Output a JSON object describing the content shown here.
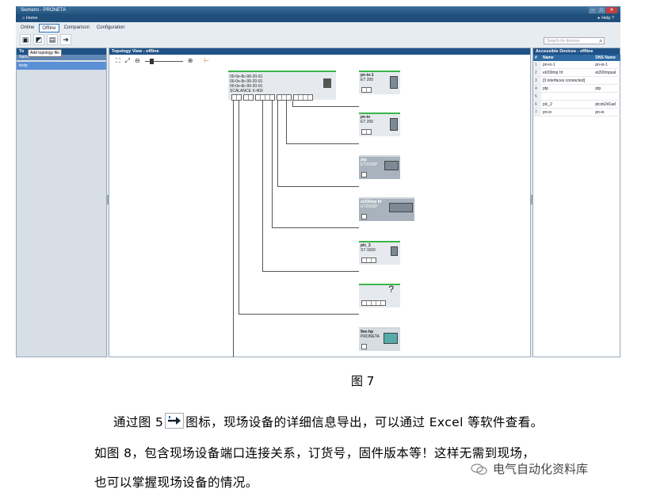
{
  "app": {
    "window_title": "Siemens - PRONETA",
    "home_label": "Home",
    "help_label": "Help ?",
    "tabs": [
      "Online",
      "Offline",
      "Comparison",
      "Configuration"
    ],
    "tooltip": "Add topology file",
    "search_placeholder": "Search for devices"
  },
  "left_panel": {
    "header": "To",
    "column": "Name",
    "item": "testp"
  },
  "topology": {
    "header": "Topology View - offline",
    "switch": {
      "macs": [
        "00-0e-8c-99-20-91",
        "00-0e-8c-99-20-91",
        "00-0e-8c-99-20-91"
      ],
      "model": "SCALANCE X-400"
    },
    "devices": [
      {
        "name": "pn-io-1",
        "type": "ET 200"
      },
      {
        "name": "pn-io",
        "type": "ET 200"
      },
      {
        "name": "ptp",
        "type": "ET200SP"
      },
      {
        "name": "et200mp hf",
        "type": "ET200SP"
      },
      {
        "name": "plc_2",
        "type": "S7-1500"
      },
      {
        "name": "",
        "type": "?"
      },
      {
        "name": "9ee-hp",
        "type": "PRONETA"
      }
    ]
  },
  "accessible_devices": {
    "header": "Accessible Devices - offline",
    "columns": [
      "#",
      "Name",
      "DNS Name"
    ],
    "rows": [
      {
        "n": "1",
        "name": "pn-io-1",
        "dns": "pn-io-1"
      },
      {
        "n": "2",
        "name": "et200mp hf",
        "dns": "et200mpsal"
      },
      {
        "n": "3",
        "name": "[3 interfaces connected]",
        "dns": ""
      },
      {
        "n": "4",
        "name": "ptp",
        "dns": "ptp"
      },
      {
        "n": "5",
        "name": "",
        "dns": ""
      },
      {
        "n": "6",
        "name": "plc_2",
        "dns": "plcxb2d1ad"
      },
      {
        "n": "7",
        "name": "pn-io",
        "dns": "pn-io"
      }
    ]
  },
  "document": {
    "caption": "图 7",
    "para1_a": "通过图 5",
    "para1_b": "图标，现场设备的详细信息导出，可以通过 Excel 等软件查看。",
    "para2": "如图 8，包含现场设备端口连接关系，订货号，固件版本等！这样无需到现场，",
    "para3": "也可以掌握现场设备的情况。",
    "watermark": "电气自动化资料库"
  }
}
